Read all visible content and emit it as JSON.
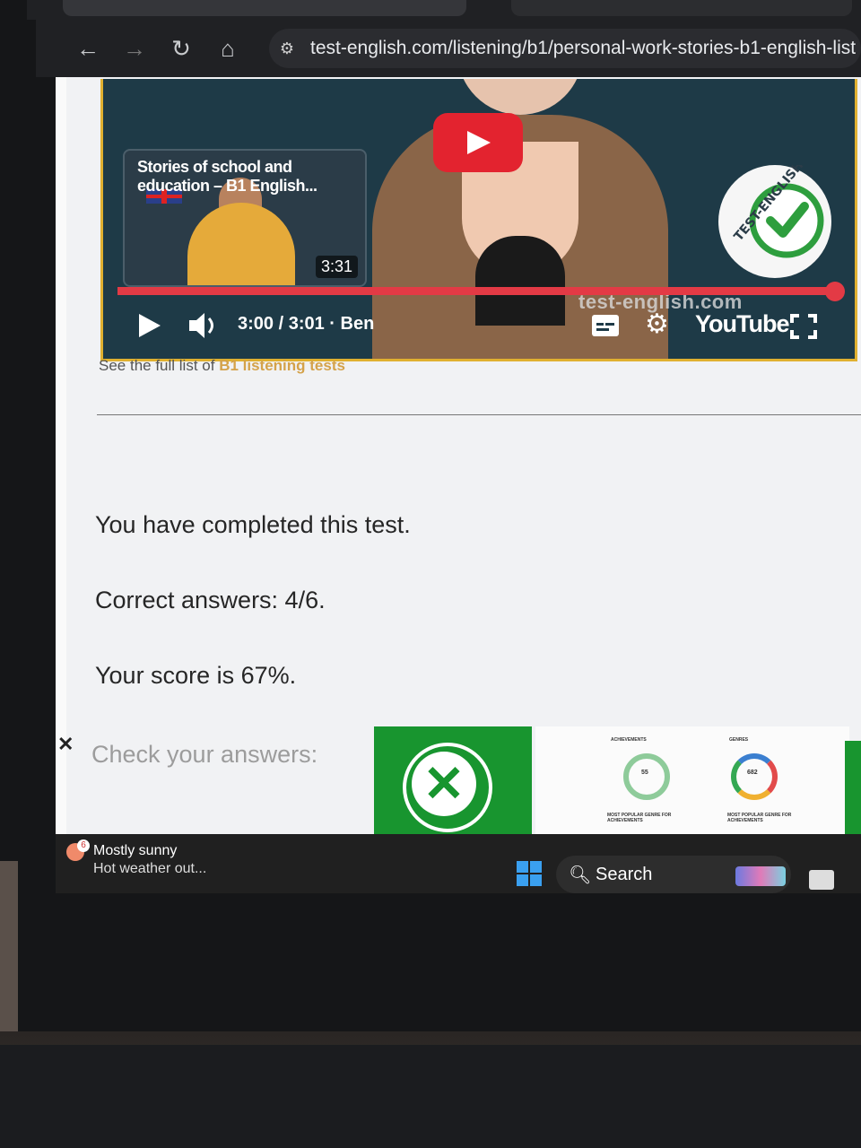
{
  "browser": {
    "url": "test-english.com/listening/b1/personal-work-stories-b1-english-list"
  },
  "player": {
    "endcard_title": "Stories of school and education – B1 English...",
    "endcard_duration": "3:31",
    "time": "3:00 / 3:01 · Ben",
    "progress": 0.99,
    "watermark": "test-english.com",
    "youtube_label": "YouTube",
    "logo_text": "TEST-ENGLISH"
  },
  "page": {
    "see_list_prefix": "See the full list of ",
    "see_list_link": "B1 listening tests",
    "completed": "You have completed this test.",
    "correct": "Correct answers: 4/6.",
    "score": "Your score is 67%.",
    "check": "Check your answers:"
  },
  "ad": {
    "label1": "ACHIEVEMENTS",
    "label2": "GENRES",
    "stat1": "55",
    "stat2": "682",
    "caption1": "MOST POPULAR GENRE FOR ACHIEVEMENTS",
    "caption2": "MOST POPULAR GENRE FOR ACHIEVEMENTS"
  },
  "taskbar": {
    "weather_badge": "6",
    "weather_title": "Mostly sunny",
    "weather_sub": "Hot weather out...",
    "search_label": "Search"
  }
}
